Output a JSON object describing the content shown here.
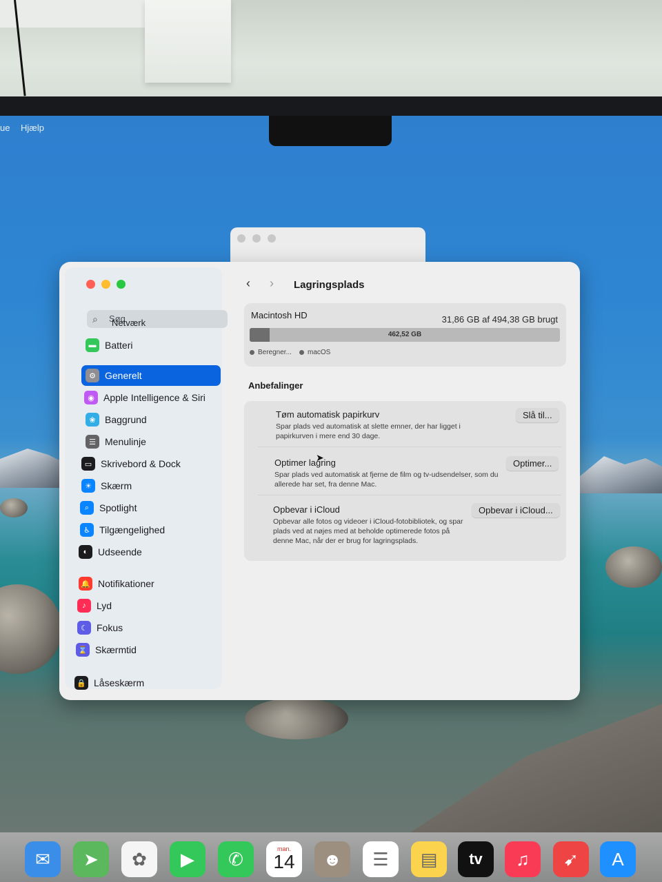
{
  "menubar": {
    "partial_left": "ue",
    "help": "Hjælp"
  },
  "window": {
    "title": "Lagringsplads",
    "nav": {
      "back": "‹",
      "forward": "›"
    }
  },
  "sidebar": {
    "search_placeholder": "Søg",
    "overlap_item": "Netværk",
    "items": [
      {
        "label": "Batteri",
        "icon": "battery-icon",
        "color": "#34c759",
        "glyph": "▬"
      },
      {
        "label": "Generelt",
        "icon": "gear-icon",
        "color": "#8e8e93",
        "glyph": "⚙",
        "selected": true
      },
      {
        "label": "Apple Intelligence & Siri",
        "icon": "siri-icon",
        "color": "#bf5af2",
        "glyph": "◉"
      },
      {
        "label": "Baggrund",
        "icon": "wallpaper-icon",
        "color": "#32ade6",
        "glyph": "❀"
      },
      {
        "label": "Menulinje",
        "icon": "menubar-icon",
        "color": "#636366",
        "glyph": "☰"
      },
      {
        "label": "Skrivebord & Dock",
        "icon": "dock-icon",
        "color": "#1c1c1e",
        "glyph": "▭"
      },
      {
        "label": "Skærm",
        "icon": "display-icon",
        "color": "#0a84ff",
        "glyph": "☀"
      },
      {
        "label": "Spotlight",
        "icon": "spotlight-icon",
        "color": "#0a84ff",
        "glyph": "⌕"
      },
      {
        "label": "Tilgængelighed",
        "icon": "accessibility-icon",
        "color": "#0a84ff",
        "glyph": "♿"
      },
      {
        "label": "Udseende",
        "icon": "appearance-icon",
        "color": "#1c1c1e",
        "glyph": "◐"
      },
      {
        "label": "Notifikationer",
        "icon": "notifications-icon",
        "color": "#ff3b30",
        "glyph": "🔔"
      },
      {
        "label": "Lyd",
        "icon": "sound-icon",
        "color": "#ff2d55",
        "glyph": "♪"
      },
      {
        "label": "Fokus",
        "icon": "focus-icon",
        "color": "#5e5ce6",
        "glyph": "☾"
      },
      {
        "label": "Skærmtid",
        "icon": "screentime-icon",
        "color": "#5e5ce6",
        "glyph": "⌛"
      },
      {
        "label": "Låseskærm",
        "icon": "lock-icon",
        "color": "#1c1c1e",
        "glyph": "🔒"
      }
    ]
  },
  "storage": {
    "disk_name": "Macintosh HD",
    "used_text": "31,86 GB af 494,38 GB brugt",
    "bar_label": "462,52 GB",
    "used_fraction": 0.064,
    "legend": [
      "Beregner...",
      "macOS"
    ]
  },
  "recommendations": {
    "title": "Anbefalinger",
    "items": [
      {
        "title": "Tøm automatisk papirkurv",
        "desc": "Spar plads ved automatisk at slette emner, der har ligget i papirkurven i mere end 30 dage.",
        "button": "Slå til..."
      },
      {
        "title": "Optimer lagring",
        "desc": "Spar plads ved automatisk at fjerne de film og tv-udsendelser, som du allerede har set, fra denne Mac.",
        "button": "Optimer..."
      },
      {
        "title": "Opbevar i iCloud",
        "desc": "Opbevar alle fotos og videoer i iCloud-fotobibliotek, og spar plads ved at nøjes med at beholde optimerede fotos på denne Mac, når der er brug for lagringsplads.",
        "button": "Opbevar i iCloud..."
      }
    ]
  },
  "dock": {
    "calendar_month": "man.",
    "calendar_day": "14",
    "tv_label": "tv",
    "apps": [
      {
        "name": "mail-icon",
        "color": "#3b8ee8",
        "glyph": "✉"
      },
      {
        "name": "maps-icon",
        "color": "#5cb85c",
        "glyph": "➤"
      },
      {
        "name": "photos-icon",
        "color": "#f5f5f5",
        "glyph": "✿"
      },
      {
        "name": "facetime-icon",
        "color": "#34c759",
        "glyph": "▶"
      },
      {
        "name": "phone-icon",
        "color": "#34c759",
        "glyph": "✆"
      },
      {
        "name": "calendar-icon",
        "color": "#ffffff",
        "glyph": ""
      },
      {
        "name": "contacts-icon",
        "color": "#9c8f7f",
        "glyph": "☻"
      },
      {
        "name": "reminders-icon",
        "color": "#ffffff",
        "glyph": "☰"
      },
      {
        "name": "notes-icon",
        "color": "#fcd34d",
        "glyph": "▤"
      },
      {
        "name": "tv-icon",
        "color": "#111111",
        "glyph": ""
      },
      {
        "name": "music-icon",
        "color": "#fa3b55",
        "glyph": "♫"
      },
      {
        "name": "launchpad-icon",
        "color": "#ef4444",
        "glyph": "➹"
      },
      {
        "name": "appstore-icon",
        "color": "#1e90ff",
        "glyph": "A"
      }
    ]
  }
}
